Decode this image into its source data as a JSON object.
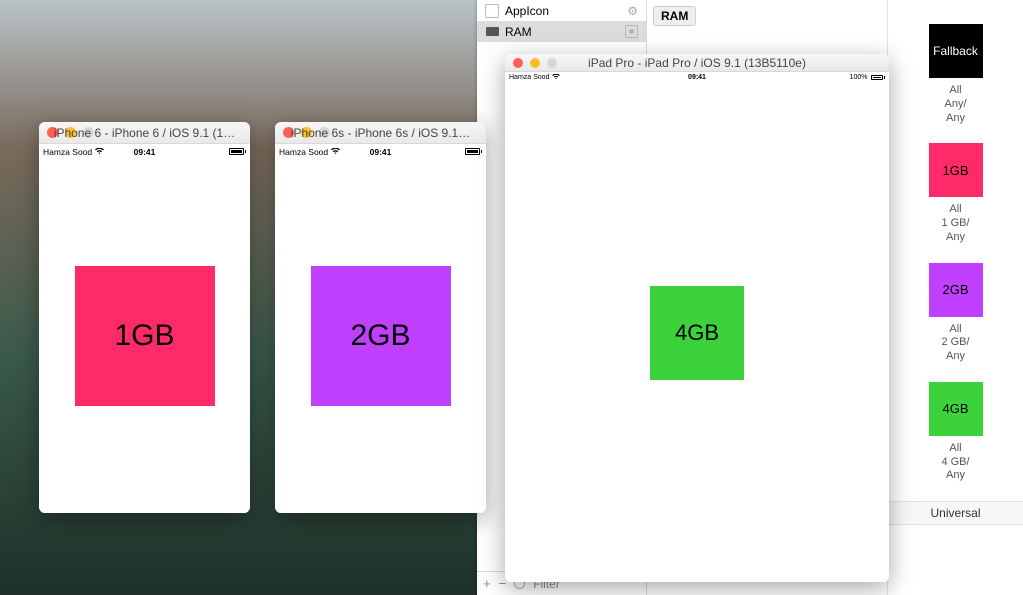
{
  "xcode": {
    "list": {
      "appicon": "AppIcon",
      "ram": "RAM"
    },
    "canvas_tag": "RAM",
    "footer": {
      "plus": "+",
      "minus": "−",
      "filter": "Filter"
    },
    "inspector": {
      "fallback": {
        "label": "Fallback",
        "line1": "All",
        "line2": "Any/",
        "line3": "Any"
      },
      "s1": {
        "label": "1GB",
        "line1": "All",
        "line2": "1 GB/",
        "line3": "Any"
      },
      "s2": {
        "label": "2GB",
        "line1": "All",
        "line2": "2 GB/",
        "line3": "Any"
      },
      "s4": {
        "label": "4GB",
        "line1": "All",
        "line2": "4 GB/",
        "line3": "Any"
      },
      "universal": "Universal"
    }
  },
  "sims": {
    "iphone6": {
      "title": "iPhone 6 - iPhone 6 / iOS 9.1 (1…",
      "carrier": "Hamza Sood",
      "time": "09:41",
      "square": "1GB"
    },
    "iphone6s": {
      "title": "iPhone 6s - iPhone 6s / iOS 9.1…",
      "carrier": "Hamza Sood",
      "time": "09:41",
      "square": "2GB"
    },
    "ipad": {
      "title": "iPad Pro - iPad Pro / iOS 9.1 (13B5110e)",
      "carrier": "Hamza Sood",
      "time": "09:41",
      "battery_pct": "100%",
      "square": "4GB"
    }
  }
}
